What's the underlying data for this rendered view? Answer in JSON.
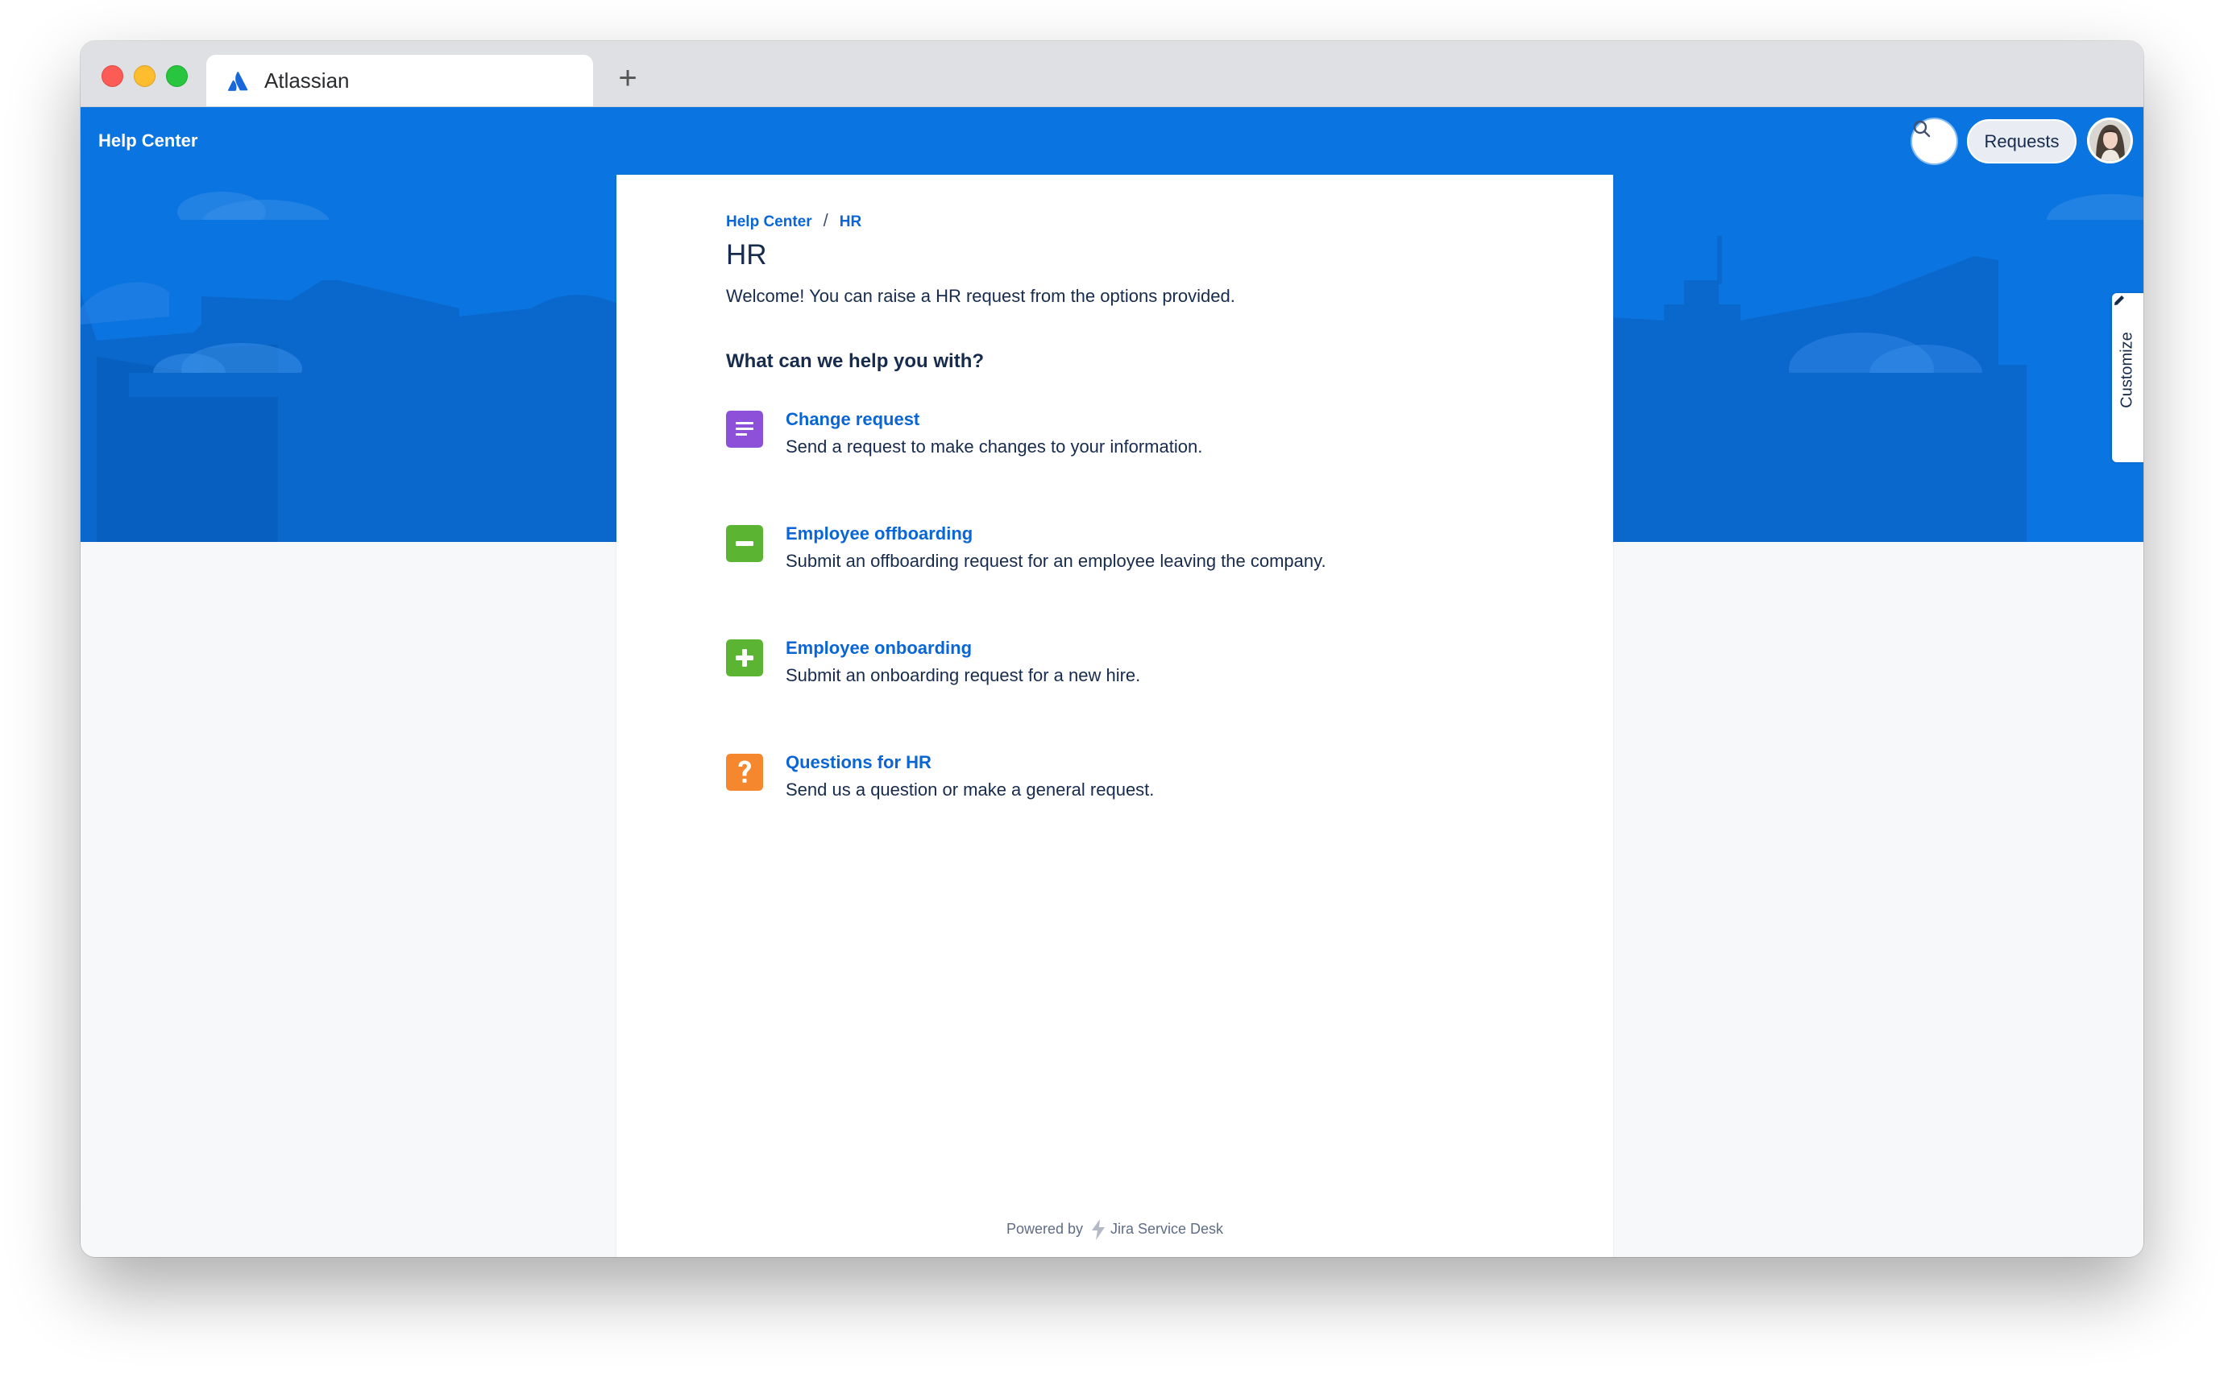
{
  "browser": {
    "tab_title": "Atlassian",
    "new_tab_label": "+"
  },
  "topbar": {
    "help_center_label": "Help Center",
    "requests_label": "Requests"
  },
  "customize_label": "Customize",
  "breadcrumb": [
    "Help Center",
    "HR"
  ],
  "breadcrumb_sep": "/",
  "title": "HR",
  "welcome": "Welcome! You can raise a HR request from the options provided.",
  "help_heading": "What can we help you with?",
  "request_types": [
    {
      "name": "Change request",
      "description": "Send a request to make changes to your information.",
      "icon": "document-lines-icon",
      "color": "#8d50d9"
    },
    {
      "name": "Employee offboarding",
      "description": "Submit an offboarding request for an employee leaving the company.",
      "icon": "minus-icon",
      "color": "#5cb532"
    },
    {
      "name": "Employee onboarding",
      "description": "Submit an onboarding request for a new hire.",
      "icon": "plus-icon",
      "color": "#5cb532"
    },
    {
      "name": "Questions for HR",
      "description": "Send us a question or make a general request.",
      "icon": "question-mark-icon",
      "color": "#f5882f"
    }
  ],
  "footer": {
    "powered_by": "Powered by",
    "product": "Jira Service Desk"
  },
  "colors": {
    "banner": "#0a74e0",
    "link": "#0a66d6",
    "text": "#172b4d"
  }
}
